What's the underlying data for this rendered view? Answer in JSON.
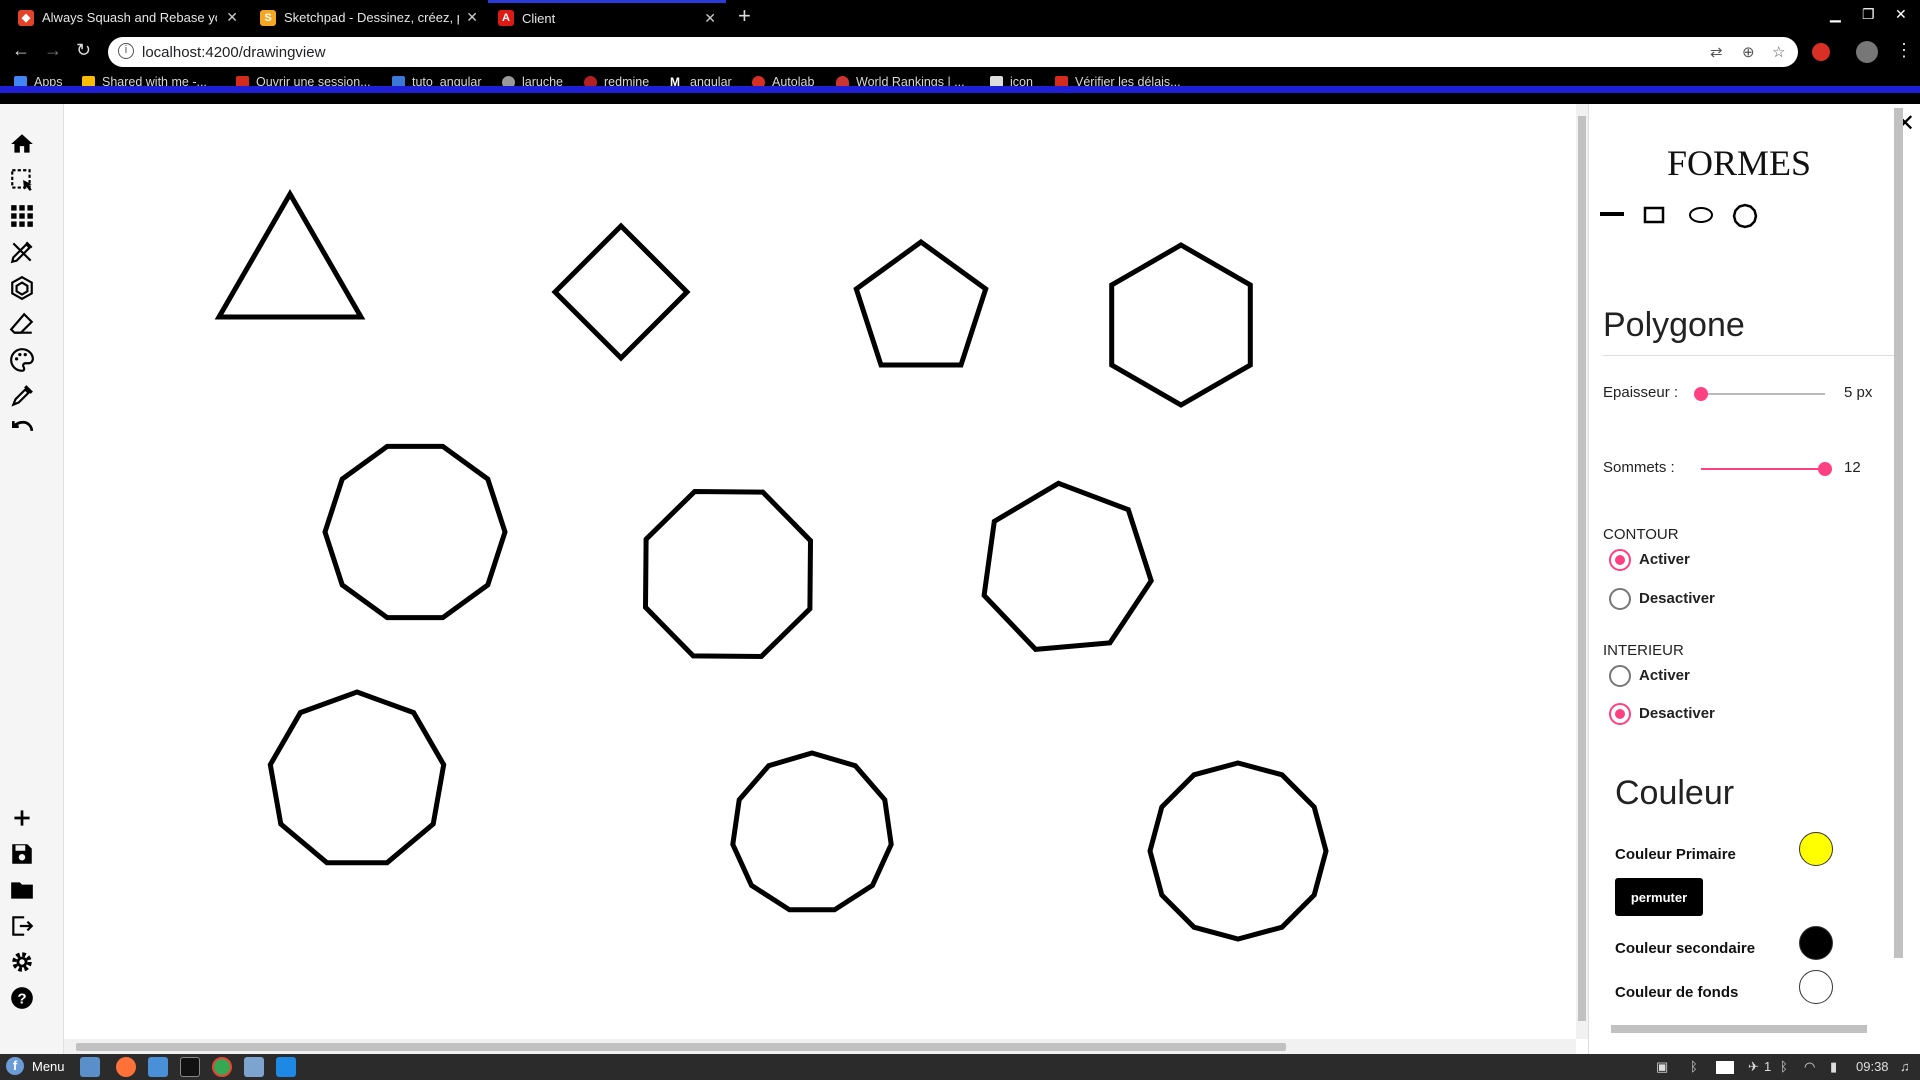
{
  "browser": {
    "tabs": [
      {
        "title": "Always Squash and Rebase you",
        "icon": "gitlab-icon",
        "color": "#e24329",
        "active": false
      },
      {
        "title": "Sketchpad - Dessinez, créez, pa",
        "icon": "sketchpad-icon",
        "color": "#f5a623",
        "active": false
      },
      {
        "title": "Client",
        "icon": "angular-icon",
        "color": "#dd1b16",
        "active": true
      }
    ],
    "url": "localhost:4200/drawingview",
    "bookmarks": [
      {
        "label": "Apps",
        "color": "#4285f4"
      },
      {
        "label": "Shared with me -...",
        "color": "#fbbc05"
      },
      {
        "label": "Ouvrir une session...",
        "color": "#d52b1e"
      },
      {
        "label": "tuto_angular",
        "color": "#3c78d8"
      },
      {
        "label": "laruche",
        "color": "#999999"
      },
      {
        "label": "redmine",
        "color": "#b32024"
      },
      {
        "label": "angular",
        "color": "#ffffff"
      },
      {
        "label": "Autolab",
        "color": "#d93025"
      },
      {
        "label": "World Rankings | ...",
        "color": "#cc3333"
      },
      {
        "label": "icon",
        "color": "#dddddd"
      },
      {
        "label": "Vérifier les délais...",
        "color": "#d52b1e"
      }
    ]
  },
  "sidebar": {
    "top_tools": [
      "home-icon",
      "selection-icon",
      "grid-icon",
      "pencil-tools-icon",
      "polygon-icon",
      "eraser-icon",
      "palette-icon",
      "pipette-icon",
      "undo-icon"
    ],
    "bottom_tools": [
      "add-icon",
      "save-icon",
      "folder-icon",
      "export-icon",
      "settings-icon",
      "help-icon"
    ]
  },
  "canvas": {
    "stroke_color": "#000000",
    "polygons": [
      {
        "sides": 3,
        "rotation": 0
      },
      {
        "sides": 4,
        "rotation": 0
      },
      {
        "sides": 5,
        "rotation": 0
      },
      {
        "sides": 6,
        "rotation": 0
      },
      {
        "sides": 10,
        "rotation": 0
      },
      {
        "sides": 8,
        "rotation": 0
      },
      {
        "sides": 7,
        "rotation": 0
      },
      {
        "sides": 9,
        "rotation": 0
      },
      {
        "sides": 11,
        "rotation": 0
      },
      {
        "sides": 12,
        "rotation": 0
      }
    ]
  },
  "panel": {
    "formes_title": "FORMES",
    "shape_buttons": [
      "line-icon",
      "rectangle-icon",
      "ellipse-icon",
      "polygon-shape-icon"
    ],
    "polygon_title": "Polygone",
    "epaisseur": {
      "label": "Epaisseur :",
      "value": "5 px",
      "fraction": 0.0
    },
    "sommets": {
      "label": "Sommets :",
      "value": "12",
      "fraction": 1.0
    },
    "contour": {
      "label": "CONTOUR",
      "activer": "Activer",
      "desactiver": "Desactiver",
      "selected": "activer"
    },
    "interieur": {
      "label": "INTERIEUR",
      "activer": "Activer",
      "desactiver": "Desactiver",
      "selected": "desactiver"
    },
    "couleur_title": "Couleur",
    "primary": {
      "label": "Couleur Primaire",
      "color": "#ffff00"
    },
    "permuter": "permuter",
    "secondary": {
      "label": "Couleur secondaire",
      "color": "#000000"
    },
    "background": {
      "label": "Couleur de fonds",
      "color": "#ffffff"
    },
    "accent_color": "#ff4081"
  },
  "taskbar": {
    "menu": "Menu",
    "clock": "09:38",
    "notification_count": "1"
  }
}
